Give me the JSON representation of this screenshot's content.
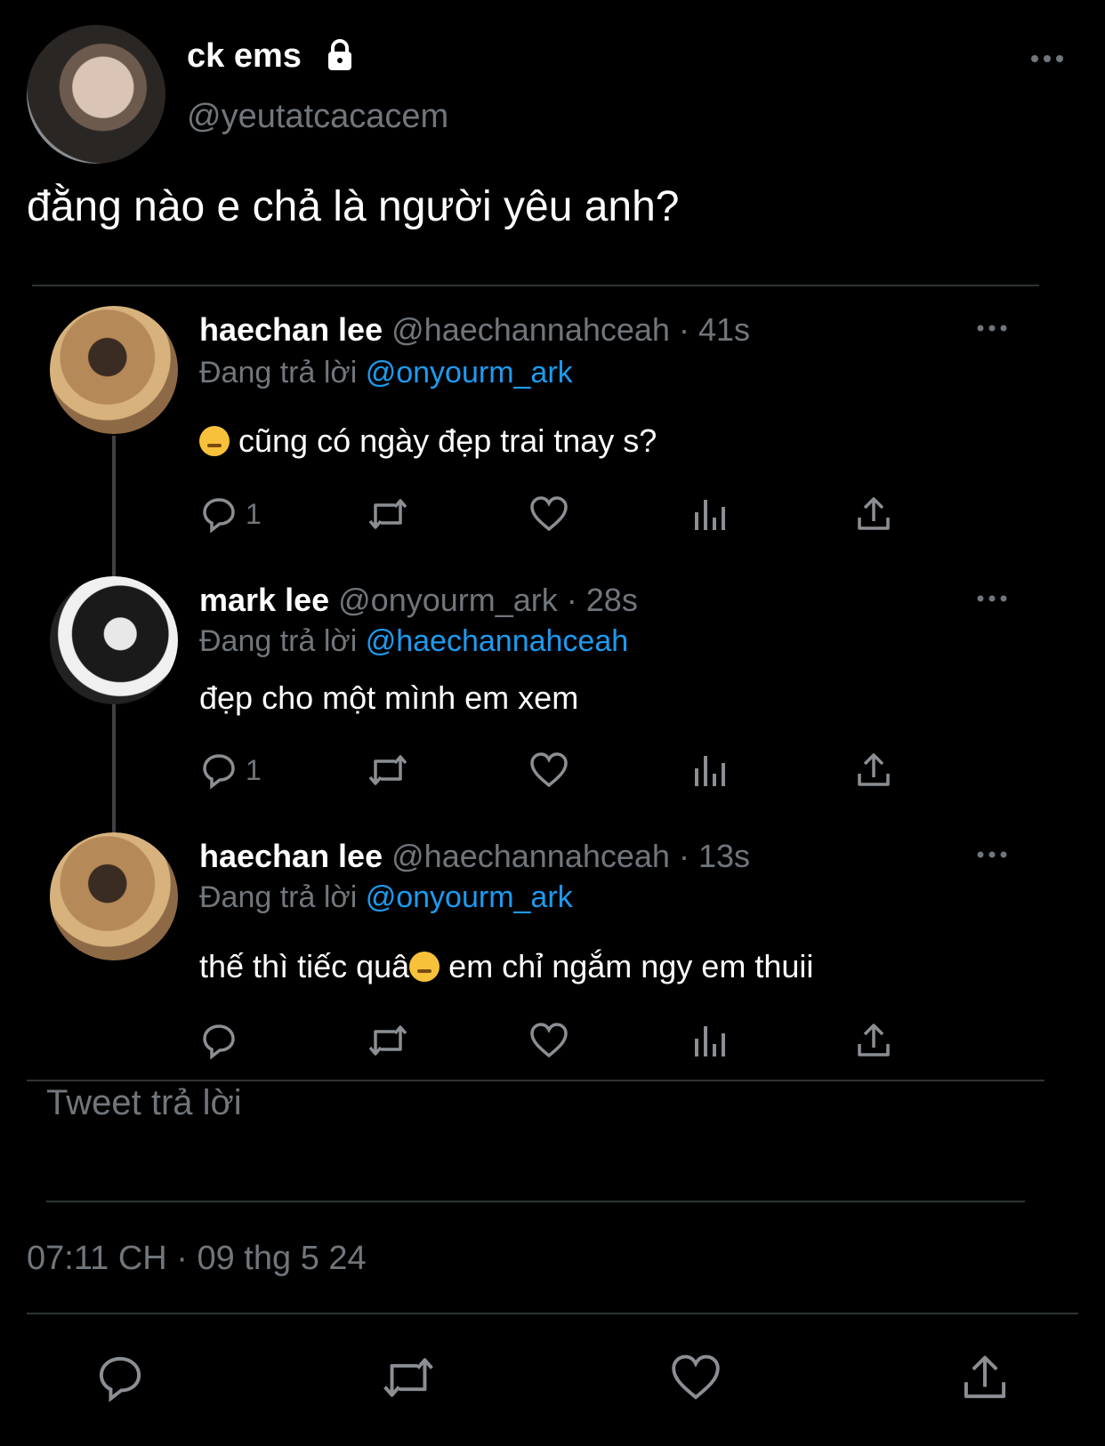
{
  "main_tweet": {
    "display_name": "ck ems",
    "handle": "@yeutatcacacem",
    "text": "đằng nào e chả là người yêu anh?",
    "icons": {
      "lock": "lock-icon",
      "more": "more-icon"
    }
  },
  "thread": [
    {
      "name": "haechan lee",
      "handle": "@haechannahceah",
      "time": "· 41s",
      "reply_prefix": "Đang trả lời",
      "reply_to": "@onyourm_ark",
      "emoji": "face-with-hand-over-mouth-emoji",
      "text": "cũng có ngày đẹp trai tnay s?",
      "reply_count": "1"
    },
    {
      "name": "mark lee",
      "handle": "@onyourm_ark",
      "time": "· 28s",
      "reply_prefix": "Đang trả lời",
      "reply_to": "@haechannahceah",
      "text": "đẹp cho một mình em xem",
      "reply_count": "1"
    },
    {
      "name": "haechan lee",
      "handle": "@haechannahceah",
      "time": "· 13s",
      "reply_prefix": "Đang trả lời",
      "reply_to": "@onyourm_ark",
      "text_before": "thế thì tiếc quâ",
      "emoji": "disappointed-face-emoji",
      "text_after": " em chỉ ngắm ngy em thuii",
      "reply_count": ""
    }
  ],
  "reply_composer": {
    "placeholder": "Tweet trả lời"
  },
  "timestamp": "07:11 CH · 09 thg 5 24",
  "colors": {
    "background": "#000000",
    "text": "#ffffff",
    "muted": "#71767b",
    "accent": "#1d9bf0"
  }
}
